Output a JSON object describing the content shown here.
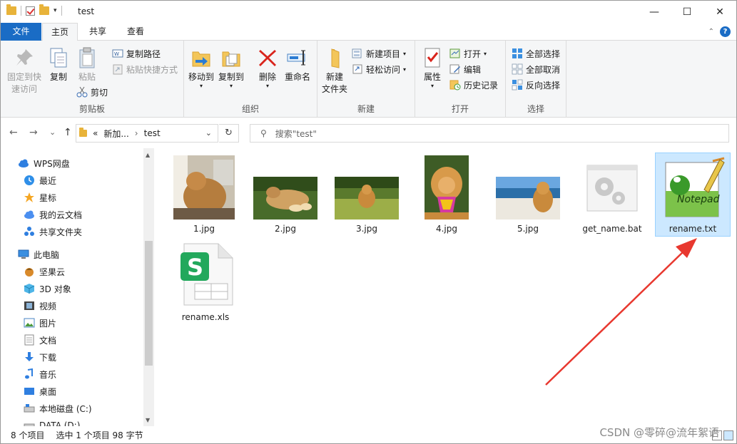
{
  "window": {
    "title": "test",
    "minimize": "—",
    "maximize": "☐",
    "close": "✕"
  },
  "tabs": {
    "file": "文件",
    "home": "主页",
    "share": "共享",
    "view": "查看"
  },
  "ribbon": {
    "clipboard": {
      "label": "剪贴板",
      "pin": "固定到快\n速访问",
      "copy": "复制",
      "paste": "粘贴",
      "copy_path": "复制路径",
      "paste_shortcut": "粘贴快捷方式",
      "cut": "剪切"
    },
    "organize": {
      "label": "组织",
      "move_to": "移动到",
      "copy_to": "复制到",
      "delete": "删除",
      "rename": "重命名"
    },
    "new": {
      "label": "新建",
      "new_folder": "新建\n文件夹",
      "new_item": "新建项目",
      "easy_access": "轻松访问"
    },
    "open": {
      "label": "打开",
      "properties": "属性",
      "open": "打开",
      "edit": "编辑",
      "history": "历史记录"
    },
    "select": {
      "label": "选择",
      "select_all": "全部选择",
      "select_none": "全部取消",
      "invert": "反向选择"
    }
  },
  "nav": {
    "back": "←",
    "forward": "→",
    "recent": "⌄",
    "up": "↑",
    "crumb_more": "«",
    "crumb1": "新加...",
    "crumb2": "test",
    "refresh": "↻",
    "search_placeholder": "搜索\"test\""
  },
  "sidebar": {
    "items": [
      {
        "label": "WPS网盘",
        "icon": "cloud-icon"
      },
      {
        "label": "最近",
        "icon": "clock-icon"
      },
      {
        "label": "星标",
        "icon": "star-icon"
      },
      {
        "label": "我的云文档",
        "icon": "cloud-doc-icon"
      },
      {
        "label": "共享文件夹",
        "icon": "share-folder-icon"
      },
      {
        "label": "此电脑",
        "icon": "computer-icon"
      },
      {
        "label": "坚果云",
        "icon": "nut-icon"
      },
      {
        "label": "3D 对象",
        "icon": "cube-icon"
      },
      {
        "label": "视频",
        "icon": "video-icon"
      },
      {
        "label": "图片",
        "icon": "picture-icon"
      },
      {
        "label": "文档",
        "icon": "document-icon"
      },
      {
        "label": "下载",
        "icon": "download-icon"
      },
      {
        "label": "音乐",
        "icon": "music-icon"
      },
      {
        "label": "桌面",
        "icon": "desktop-icon"
      },
      {
        "label": "本地磁盘 (C:)",
        "icon": "disk-icon"
      },
      {
        "label": "DATA (D:)",
        "icon": "disk-icon"
      }
    ]
  },
  "files": [
    {
      "name": "1.jpg",
      "type": "image"
    },
    {
      "name": "2.jpg",
      "type": "image"
    },
    {
      "name": "3.jpg",
      "type": "image"
    },
    {
      "name": "4.jpg",
      "type": "image"
    },
    {
      "name": "5.jpg",
      "type": "image"
    },
    {
      "name": "get_name.bat",
      "type": "bat"
    },
    {
      "name": "rename.txt",
      "type": "txt",
      "selected": true
    },
    {
      "name": "rename.xls",
      "type": "xls"
    }
  ],
  "status": {
    "count": "8 个项目",
    "selection": "选中 1 个项目  98 字节"
  },
  "watermark": "CSDN @零碎@流年絮语",
  "colors": {
    "accent": "#1a6cc5",
    "selection": "#cce8ff",
    "arrow": "#e8382f"
  }
}
